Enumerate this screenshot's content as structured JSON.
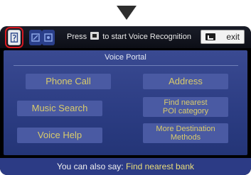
{
  "topbar": {
    "prompt_pre": "Press",
    "prompt_post": "to start Voice Recognition",
    "exit_label": "exit"
  },
  "panel": {
    "title": "Voice Portal",
    "options": {
      "phone_call": "Phone Call",
      "address": "Address",
      "music_search": "Music Search",
      "find_poi_line1": "Find nearest",
      "find_poi_line2": "POI category",
      "voice_help": "Voice Help",
      "more_dest_line1": "More Destination",
      "more_dest_line2": "Methods"
    }
  },
  "footer": {
    "prefix": "You can also say:",
    "example": "Find nearest bank"
  },
  "colors": {
    "highlight_outline": "#d71920",
    "option_text": "#d9cb6b",
    "panel_bg": "#2b3c82"
  },
  "icons": [
    "voice-portal-icon",
    "screen-mode-icon",
    "screen-mode-icon-2",
    "talk-button-icon",
    "back-icon"
  ]
}
